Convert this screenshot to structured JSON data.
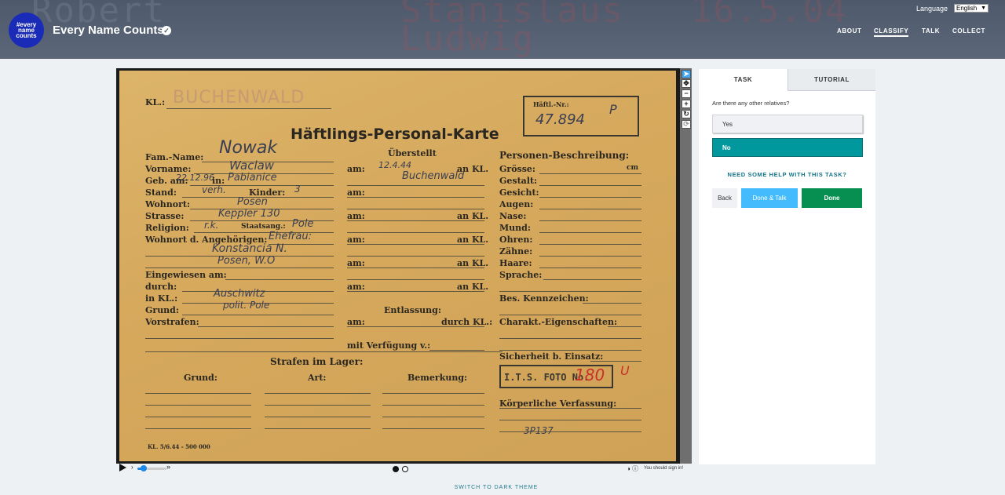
{
  "header": {
    "brand": "Every Name Counts",
    "logo_text": "#every name counts",
    "language_label": "Language",
    "language_value": "English",
    "nav": [
      {
        "label": "ABOUT"
      },
      {
        "label": "CLASSIFY"
      },
      {
        "label": "TALK"
      },
      {
        "label": "COLLECT"
      }
    ],
    "bg_words": [
      "Stanislaus",
      "Ludwig",
      "16.5.04",
      "Robert"
    ]
  },
  "document": {
    "kl_label": "KL.:",
    "kl_value": "BUCHENWALD",
    "haftl_nr_label": "Häftl.-Nr.:",
    "haftl_nr_value": "47.894",
    "stamp_p": "P",
    "title": "Häftlings-Personal-Karte",
    "left_labels": [
      "Fam.-Name:",
      "Vorname:",
      "Geb. am:",
      "Stand:",
      "Wohnort:",
      "Strasse:",
      "Religion:",
      "Wohnort d. Angehörigen:",
      "Eingewiesen am:",
      "durch:",
      "in KL.:",
      "Grund:",
      "Vorstrafen:"
    ],
    "left_values": [
      "Nowak",
      "Waclaw",
      "22.12.96",
      "verh.",
      "Posen",
      "Keppler 130",
      "r.k.",
      "Ehefrau:",
      "Konstancia N.",
      "Posen, W.O",
      "Auschwitz",
      "polit. Pole"
    ],
    "in_label": "in:",
    "in_value": "Pabianice",
    "kinder_label": "Kinder:",
    "kinder_value": "3",
    "staatsang_label": "Staatsang.:",
    "staatsang_value": "Pole",
    "ueberstellt": "Überstellt",
    "am_label": "am:",
    "ankl_label": "an KL.",
    "ueberstellt_date": "12.4.44",
    "ueberstellt_place": "Buchenwald",
    "entlassung": "Entlassung:",
    "durch_kl": "durch KL.:",
    "mit_verfuegung": "mit Verfügung v.:",
    "personen": "Personen-Beschreibung:",
    "right_labels": [
      "Grösse:",
      "Gestalt:",
      "Gesicht:",
      "Augen:",
      "Nase:",
      "Mund:",
      "Ohren:",
      "Zähne:",
      "Haare:",
      "Sprache:",
      "Bes. Kennzeichen:",
      "Charakt.-Eigenschaften:",
      "Sicherheit b. Einsatz:",
      "Körperliche Verfassung:"
    ],
    "cm": "cm",
    "strafen": "Strafen im Lager:",
    "grund": "Grund:",
    "art": "Art:",
    "bemerkung": "Bemerkung:",
    "its_stamp": "I.T.S. FOTO No.",
    "its_number": "180",
    "its_u": "U",
    "footer_code": "KL. 5/6.44 - 500 000",
    "bottom_number": "3P137"
  },
  "viewer": {
    "signin_text": "You should sign in!"
  },
  "task": {
    "tabs": {
      "task": "TASK",
      "tutorial": "TUTORIAL"
    },
    "question": "Are there any other relatives?",
    "answers": [
      {
        "label": "Yes"
      },
      {
        "label": "No"
      }
    ],
    "help": "NEED SOME HELP WITH THIS TASK?",
    "back": "Back",
    "done_talk": "Done & Talk",
    "done": "Done"
  },
  "footer": {
    "switch_theme": "SWITCH TO DARK THEME"
  },
  "colors": {
    "header": "#4e5a6b",
    "selected_answer": "#00979d",
    "done": "#078f52",
    "done_talk": "#43bbfd",
    "link": "#13748b"
  }
}
